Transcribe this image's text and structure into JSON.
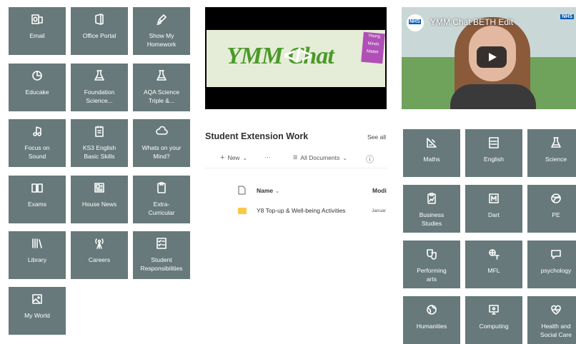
{
  "left_tiles": [
    {
      "label": "Email",
      "icon": "outlook-icon"
    },
    {
      "label": "Office Portal",
      "icon": "office-icon"
    },
    {
      "label": "Show My\nHomework",
      "icon": "pen-icon"
    },
    {
      "label": "Educake",
      "icon": "pie-chart-icon"
    },
    {
      "label": "Foundation\nScience...",
      "icon": "flask-icon"
    },
    {
      "label": "AQA Science\nTriple &...",
      "icon": "flask-icon"
    },
    {
      "label": "Focus on\nSound",
      "icon": "music-note-icon"
    },
    {
      "label": "KS3 English\nBasic Skills",
      "icon": "notepad-icon"
    },
    {
      "label": "Whats on your\nMind?",
      "icon": "cloud-icon"
    },
    {
      "label": "Exams",
      "icon": "book-icon"
    },
    {
      "label": "House News",
      "icon": "news-icon"
    },
    {
      "label": "Extra-\nCurricular",
      "icon": "clipboard-icon"
    },
    {
      "label": "Library",
      "icon": "library-icon"
    },
    {
      "label": "Careers",
      "icon": "antenna-icon"
    },
    {
      "label": "Student\nResponsibilities",
      "icon": "checklist-icon"
    },
    {
      "label": "My World",
      "icon": "image-icon"
    }
  ],
  "right_tiles": [
    {
      "label": "Maths",
      "icon": "ruler-triangle-icon"
    },
    {
      "label": "English",
      "icon": "abc-def-icon"
    },
    {
      "label": "Science",
      "icon": "flask-icon"
    },
    {
      "label": "Business\nStudies",
      "icon": "clipboard-chart-icon"
    },
    {
      "label": "Dart",
      "icon": "dart-icon"
    },
    {
      "label": "PE",
      "icon": "ball-icon"
    },
    {
      "label": "Performing\narts",
      "icon": "theatre-masks-icon"
    },
    {
      "label": "MFL",
      "icon": "translate-icon"
    },
    {
      "label": "psychology",
      "icon": "speech-bubble-icon"
    },
    {
      "label": "Humanities",
      "icon": "globe-icon"
    },
    {
      "label": "Computing",
      "icon": "computer-icon"
    },
    {
      "label": "Health and\nSocial Care",
      "icon": "heart-pulse-icon"
    }
  ],
  "video_ymm": {
    "logo_text": "YMM Chat",
    "code_glyph": "</>",
    "sticker": [
      "Young",
      "Minds",
      "Matter"
    ]
  },
  "video_beth": {
    "title": "YMM Chat BETH Edit",
    "badge": "NHS",
    "logo_badge": "NHS"
  },
  "extension_work": {
    "title": "Student Extension Work",
    "see_all": "See all",
    "toolbar": {
      "new_label": "New",
      "more_label": "···",
      "view_label": "All Documents",
      "info_label": "ⓘ"
    },
    "columns": {
      "name": "Name",
      "modified": "Modi"
    },
    "rows": [
      {
        "name": "Y8 Top-up & Well-being Activities",
        "modified": "Januar"
      }
    ]
  }
}
